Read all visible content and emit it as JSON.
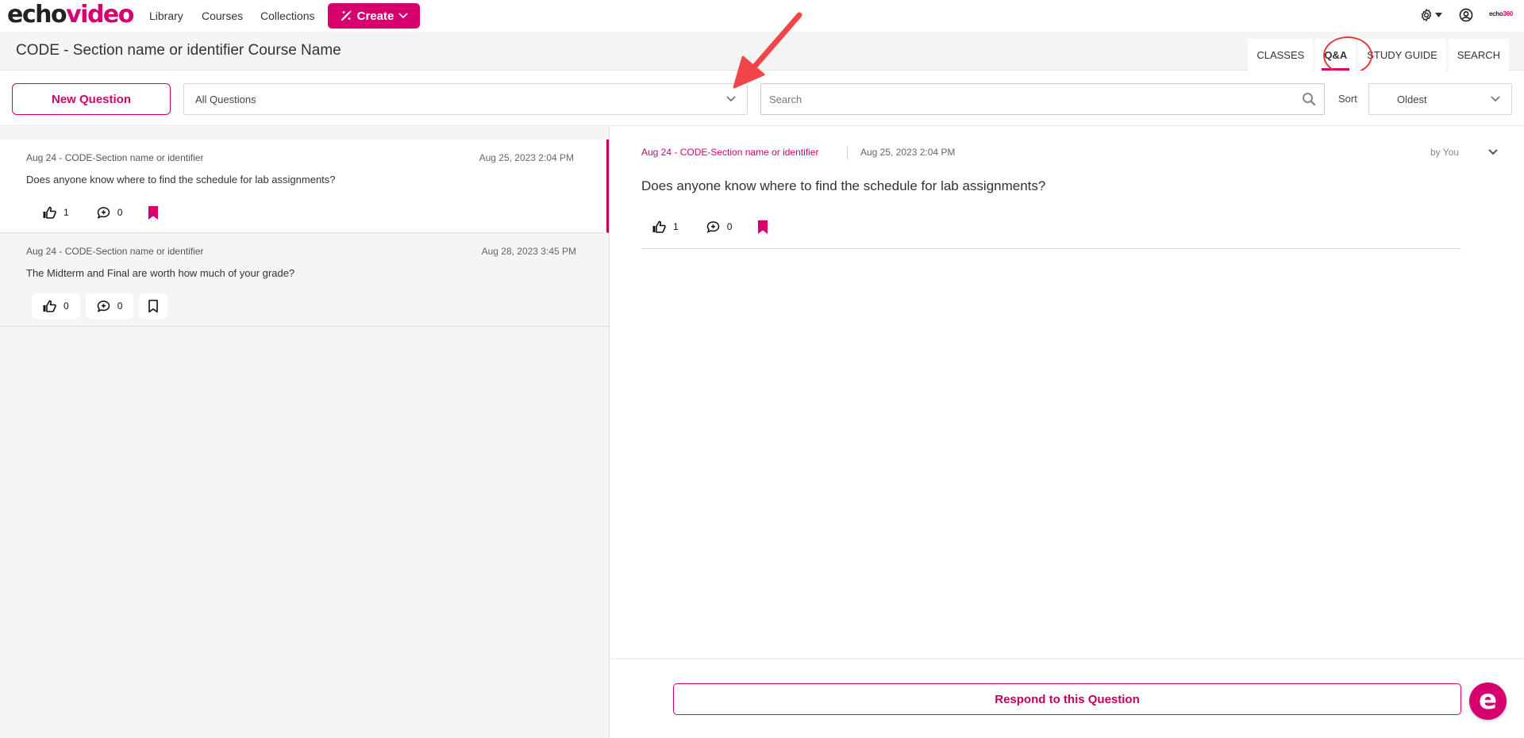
{
  "brand": {
    "logo_part1": "echo",
    "logo_part2": "video",
    "small_logo_part1": "echo",
    "small_logo_part2": "360",
    "accent": "#d6006e"
  },
  "topnav": {
    "links": [
      "Library",
      "Courses",
      "Collections"
    ],
    "create_label": "Create",
    "icons": [
      "settings-gear-icon",
      "user-account-icon"
    ]
  },
  "page": {
    "title": "CODE - Section name or identifier Course Name",
    "tabs": [
      {
        "label": "CLASSES",
        "active": false
      },
      {
        "label": "Q&A",
        "active": true
      },
      {
        "label": "STUDY GUIDE",
        "active": false
      },
      {
        "label": "SEARCH",
        "active": false
      }
    ]
  },
  "toolbar": {
    "new_question_label": "New Question",
    "filter_value": "All Questions",
    "search_placeholder": "Search",
    "sort_label": "Sort",
    "sort_value": "Oldest"
  },
  "questions": [
    {
      "section": "Aug 24 - CODE-Section name or identifier",
      "date": "Aug 25, 2023 2:04 PM",
      "text": "Does anyone know where to find the schedule for lab assignments?",
      "likes": "1",
      "replies": "0",
      "bookmarked": true,
      "selected": true
    },
    {
      "section": "Aug 24 - CODE-Section name or identifier",
      "date": "Aug 28, 2023 3:45 PM",
      "text": "The Midterm and Final are worth how much of your grade?",
      "likes": "0",
      "replies": "0",
      "bookmarked": false,
      "selected": false
    }
  ],
  "detail": {
    "section": "Aug 24 - CODE-Section name or identifier",
    "date": "Aug 25, 2023 2:04 PM",
    "author": "by You",
    "text": "Does anyone know where to find the schedule for lab assignments?",
    "likes": "1",
    "replies": "0",
    "bookmarked": true,
    "respond_label": "Respond to this Question"
  },
  "chat_bubble_label": "e"
}
